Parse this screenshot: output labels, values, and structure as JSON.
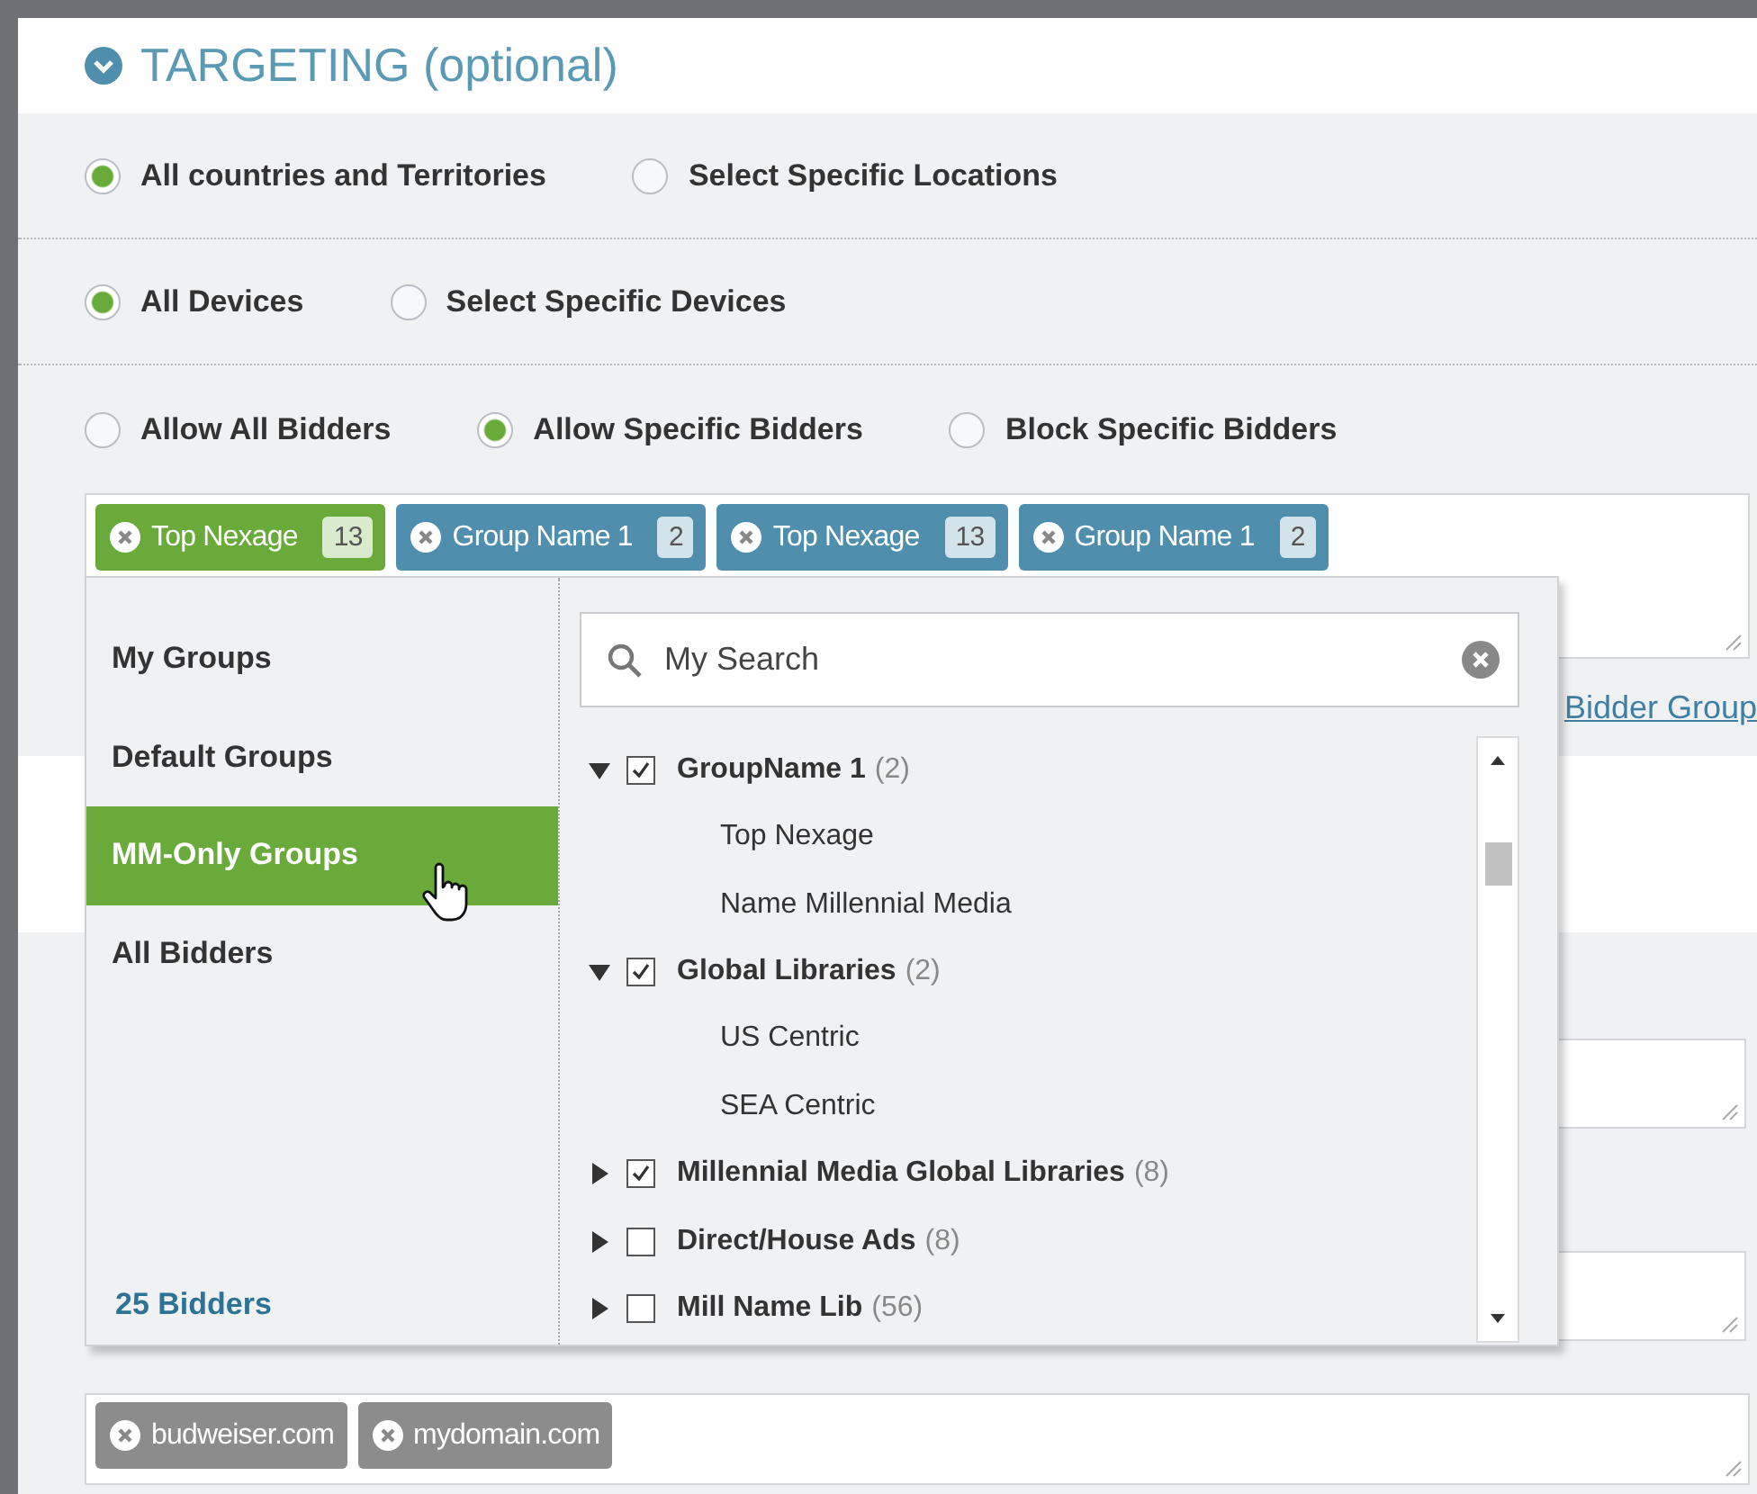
{
  "section": {
    "title": "TARGETING (optional)",
    "expanded": true
  },
  "radio_groups": [
    [
      {
        "label": "All countries and Territories",
        "selected": true
      },
      {
        "label": "Select Specific Locations",
        "selected": false
      }
    ],
    [
      {
        "label": "All Devices",
        "selected": true
      },
      {
        "label": "Select Specific Devices",
        "selected": false
      }
    ],
    [
      {
        "label": "Allow All Bidders",
        "selected": false
      },
      {
        "label": "Allow Specific Bidders",
        "selected": true
      },
      {
        "label": "Block Specific Bidders",
        "selected": false
      }
    ]
  ],
  "bidder_tags": [
    {
      "label": "Top Nexage",
      "count": "13",
      "color": "#6aaa3a"
    },
    {
      "label": "Group Name 1",
      "count": "2",
      "color": "#4f8ead"
    },
    {
      "label": "Top Nexage",
      "count": "13",
      "color": "#4f8ead"
    },
    {
      "label": "Group Name 1",
      "count": "2",
      "color": "#4f8ead"
    }
  ],
  "link": "Bidder Group",
  "dropdown": {
    "categories": [
      {
        "label": "My Groups",
        "selected": false
      },
      {
        "label": "Default Groups",
        "selected": false
      },
      {
        "label": "MM-Only Groups",
        "selected": true
      },
      {
        "label": "All Bidders",
        "selected": false
      }
    ],
    "footer": "25 Bidders",
    "search": {
      "value": "My Search"
    },
    "tree": [
      {
        "label": "GroupName 1",
        "count": "(2)",
        "checked": true,
        "expanded": true,
        "children": [
          {
            "label": "Top Nexage"
          },
          {
            "label": "Name Millennial Media"
          }
        ]
      },
      {
        "label": "Global Libraries",
        "count": "(2)",
        "checked": true,
        "expanded": true,
        "children": [
          {
            "label": "US Centric"
          },
          {
            "label": "SEA Centric"
          }
        ]
      },
      {
        "label": "Millennial Media Global Libraries",
        "count": "(8)",
        "checked": true,
        "expanded": false
      },
      {
        "label": "Direct/House Ads",
        "count": "(8)",
        "checked": false,
        "expanded": false
      },
      {
        "label": "Mill Name Lib",
        "count": "(56)",
        "checked": false,
        "expanded": false
      }
    ]
  },
  "domain_tags": [
    {
      "label": "budweiser.com"
    },
    {
      "label": "mydomain.com"
    }
  ]
}
